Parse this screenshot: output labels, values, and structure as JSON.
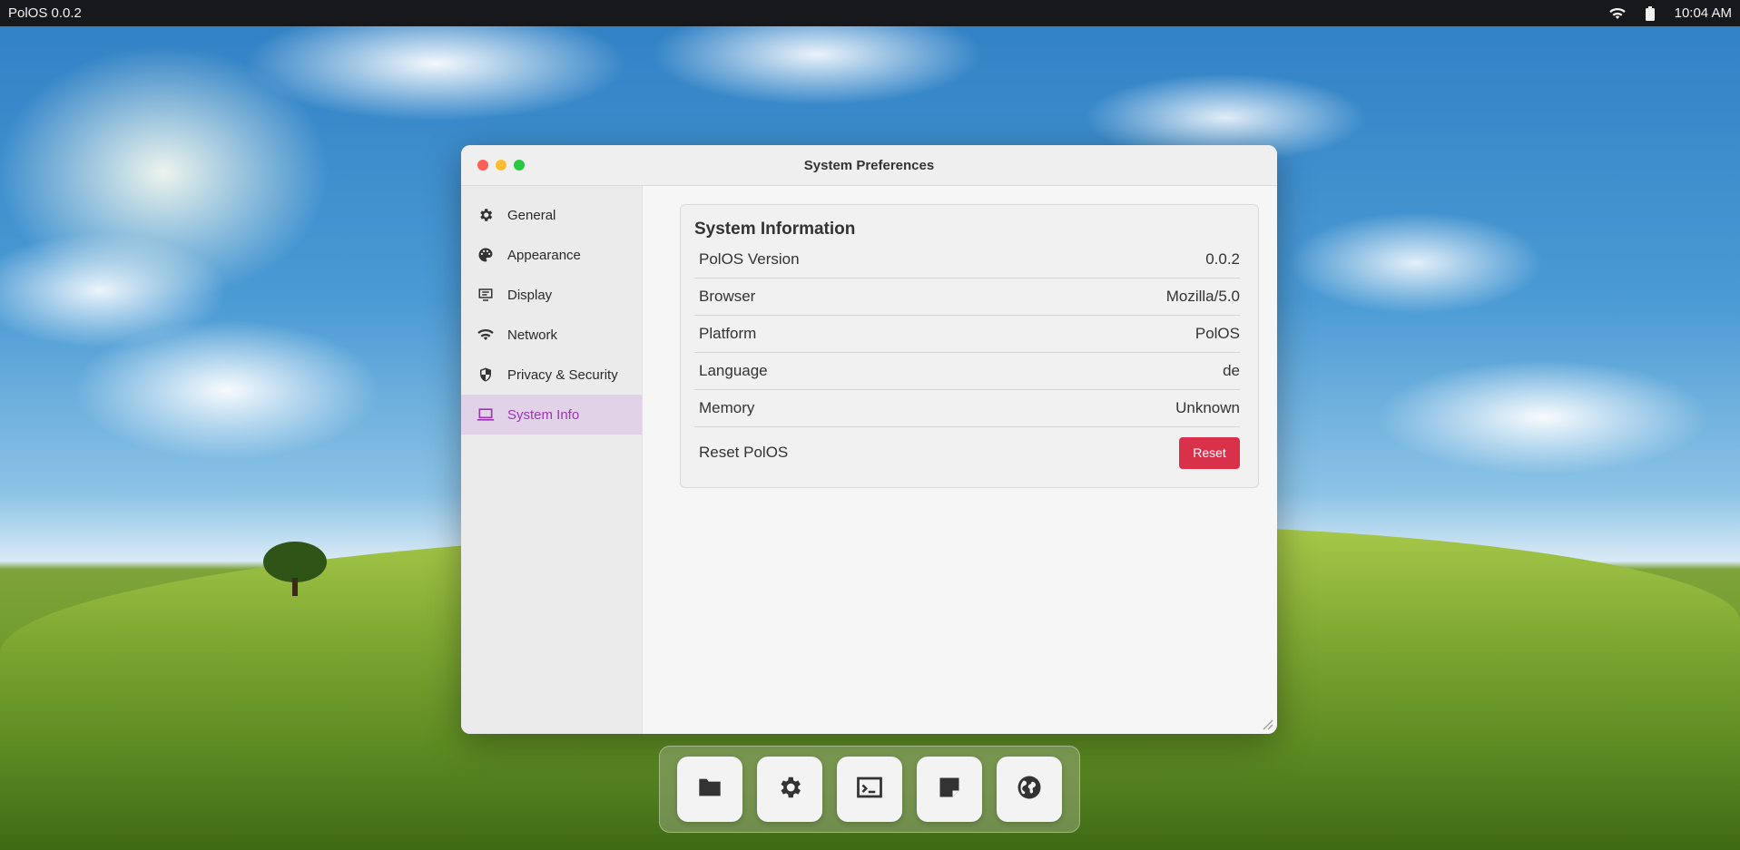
{
  "topbar": {
    "os_label": "PolOS 0.0.2",
    "wifi_icon": "wifi-icon",
    "battery_icon": "battery-icon",
    "clock": "10:04 AM"
  },
  "window": {
    "title": "System Preferences",
    "controls": [
      "close",
      "minimize",
      "maximize"
    ]
  },
  "sidebar": {
    "items": [
      {
        "label": "General",
        "icon": "gear-icon"
      },
      {
        "label": "Appearance",
        "icon": "palette-icon"
      },
      {
        "label": "Display",
        "icon": "display-icon"
      },
      {
        "label": "Network",
        "icon": "wifi-icon"
      },
      {
        "label": "Privacy & Security",
        "icon": "shield-icon"
      },
      {
        "label": "System Info",
        "icon": "laptop-icon",
        "active": true
      }
    ]
  },
  "system_info": {
    "heading": "System Information",
    "rows": [
      {
        "label": "PolOS Version",
        "value": "0.0.2"
      },
      {
        "label": "Browser",
        "value": "Mozilla/5.0"
      },
      {
        "label": "Platform",
        "value": "PolOS"
      },
      {
        "label": "Language",
        "value": "de"
      },
      {
        "label": "Memory",
        "value": "Unknown"
      }
    ],
    "reset_label": "Reset PolOS",
    "reset_button": "Reset"
  },
  "dock": {
    "apps": [
      "folder-icon",
      "settings-icon",
      "terminal-icon",
      "notes-icon",
      "globe-icon"
    ]
  },
  "colors": {
    "accent": "#9c34b8",
    "active_bg": "#e2d2e8",
    "danger": "#d9314a",
    "topbar": "#16181b"
  }
}
